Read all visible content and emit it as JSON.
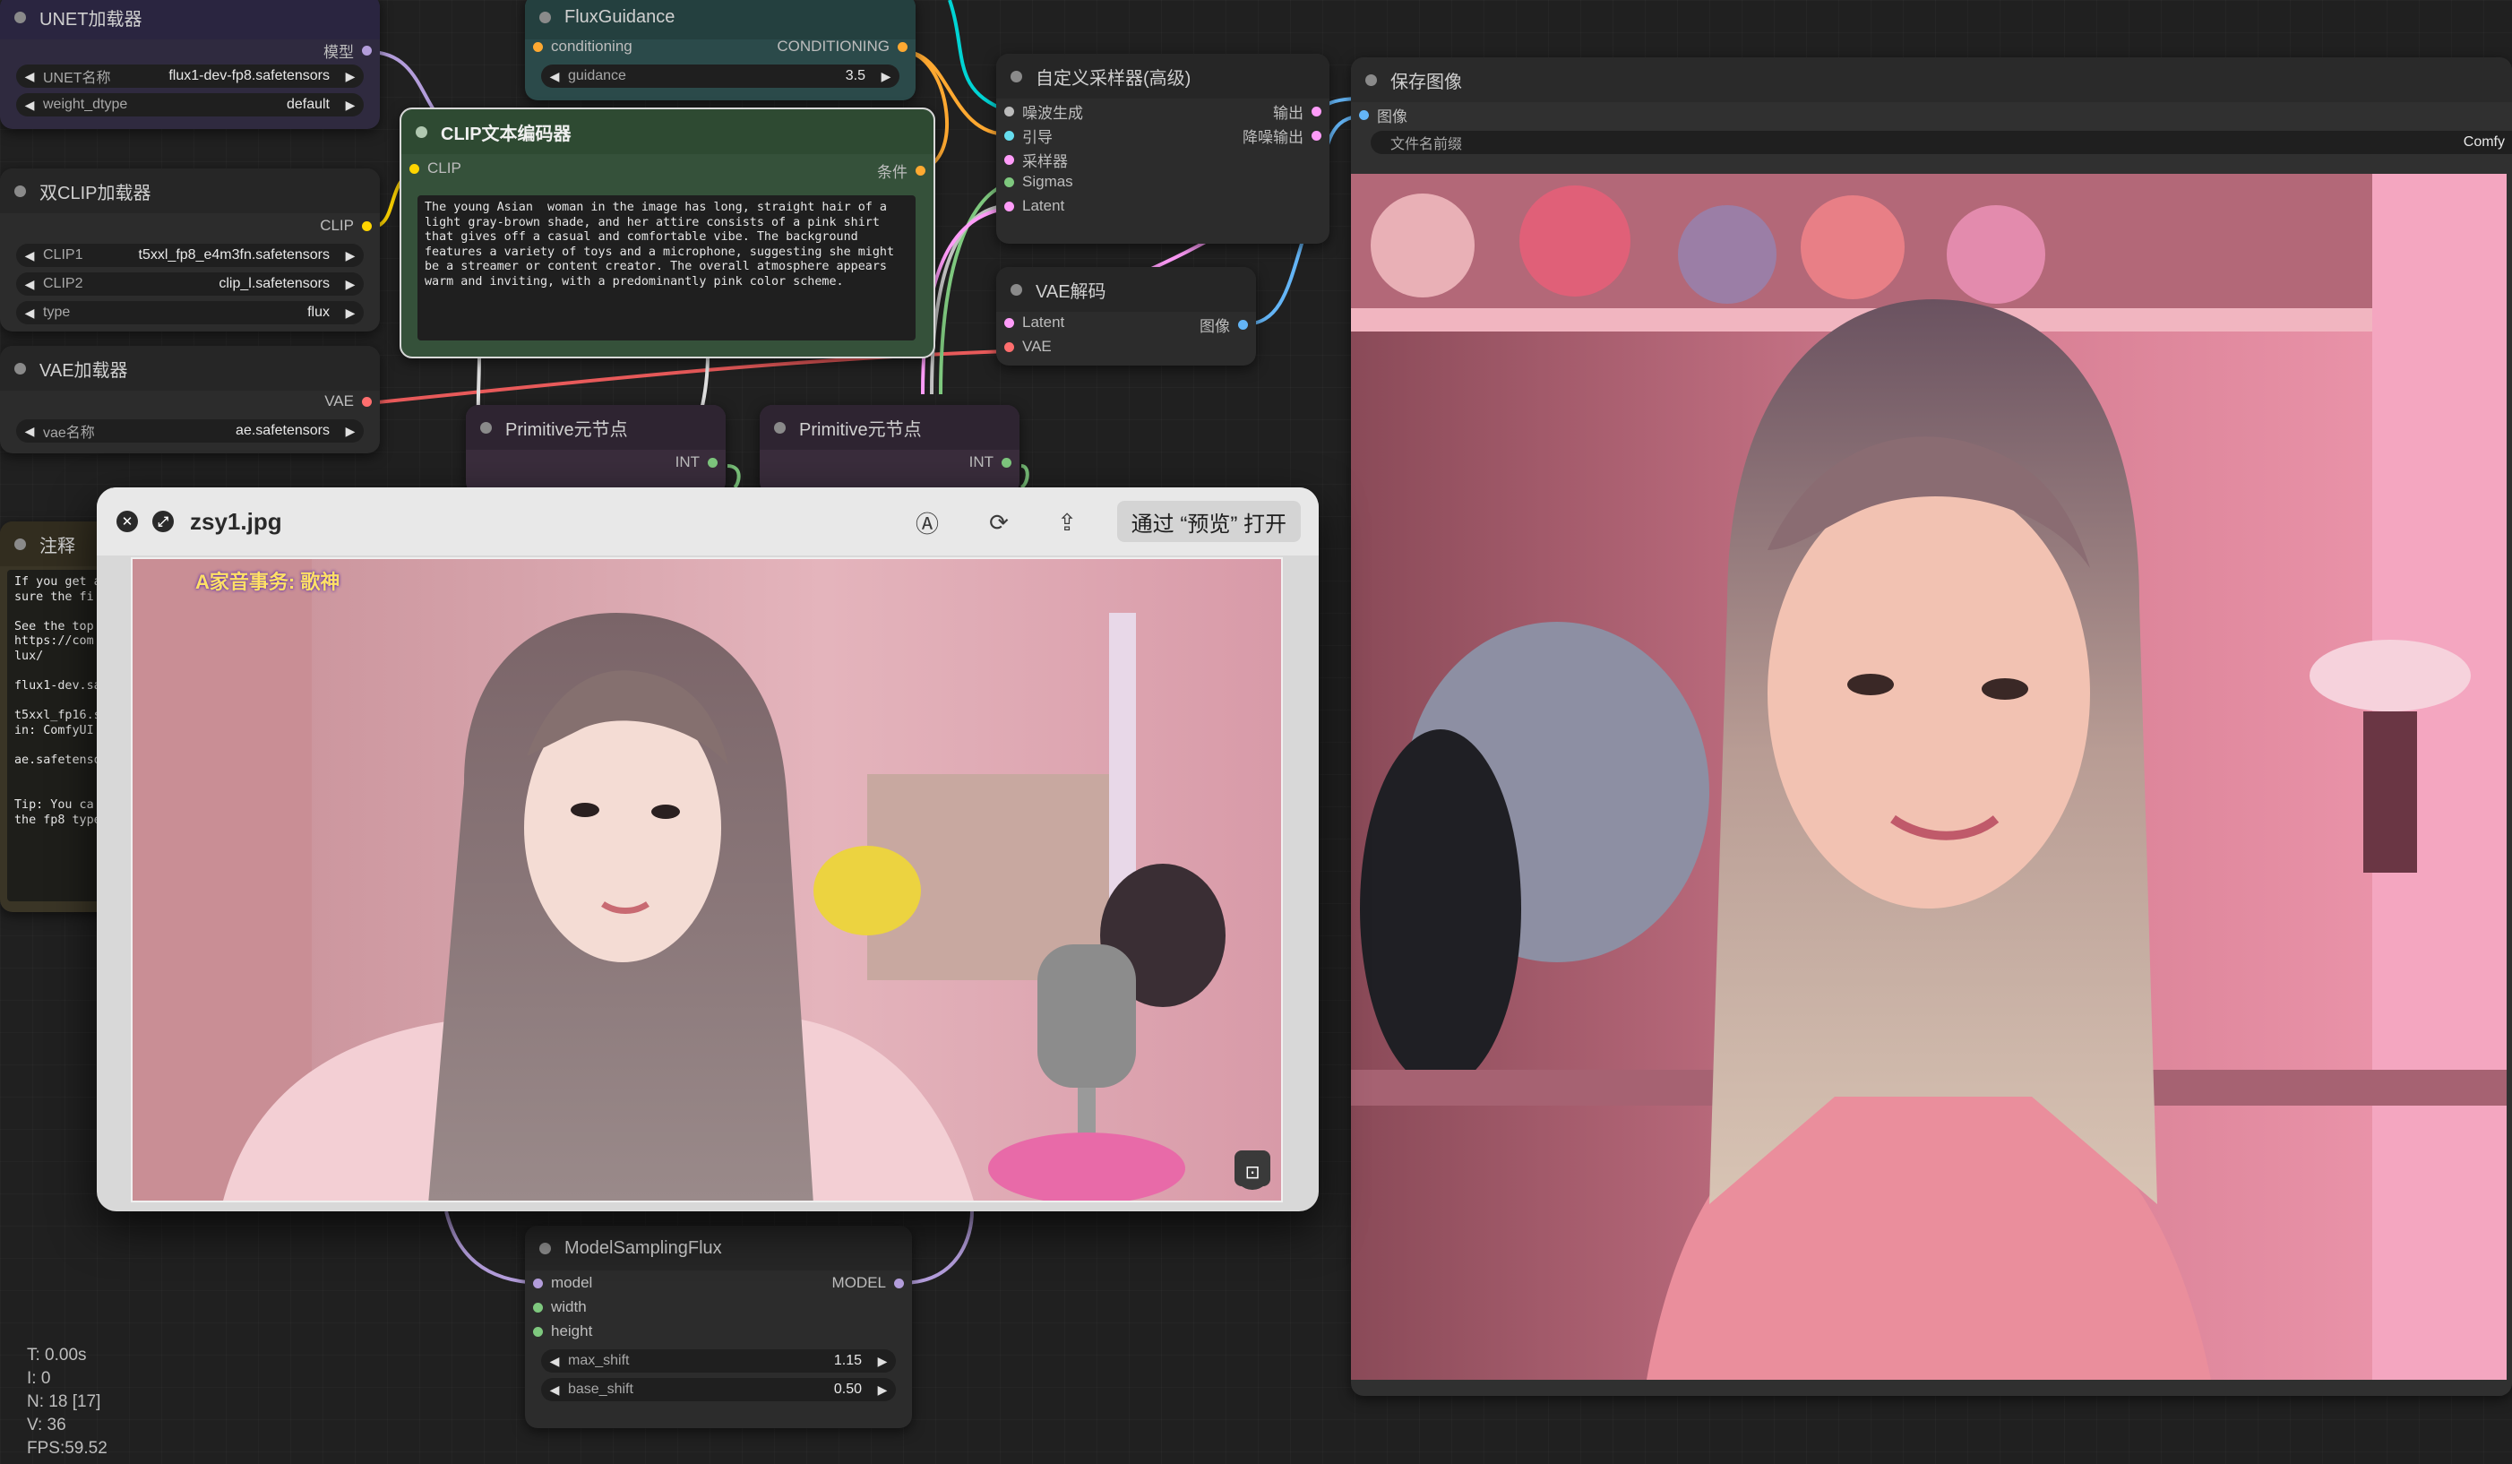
{
  "nodes": {
    "unet": {
      "title": "UNET加载器",
      "out_model": "模型",
      "w1_label": "UNET名称",
      "w1_value": "flux1-dev-fp8.safetensors",
      "w2_label": "weight_dtype",
      "w2_value": "default"
    },
    "dual_clip": {
      "title": "双CLIP加载器",
      "out_clip": "CLIP",
      "w1_label": "CLIP1",
      "w1_value": "t5xxl_fp8_e4m3fn.safetensors",
      "w2_label": "CLIP2",
      "w2_value": "clip_l.safetensors",
      "w3_label": "type",
      "w3_value": "flux"
    },
    "vae_loader": {
      "title": "VAE加载器",
      "out_vae": "VAE",
      "w1_label": "vae名称",
      "w1_value": "ae.safetensors"
    },
    "note": {
      "title": "注释",
      "text": "If you get a\nsure the fi\n\nSee the top\nhttps://com\nlux/\n\nflux1-dev.sa\n\nt5xxl_fp16.s\nin: ComfyUI\n\nae.safetenso\n\n\nTip: You ca\nthe fp8 type"
    },
    "flux_guidance": {
      "title": "FluxGuidance",
      "in_cond": "conditioning",
      "out_cond": "CONDITIONING",
      "w1_label": "guidance",
      "w1_value": "3.5"
    },
    "clip_text": {
      "title": "CLIP文本编码器",
      "in_clip": "CLIP",
      "out_cond": "条件",
      "text": "The young Asian  woman in the image has long, straight hair of a light gray-brown shade, and her attire consists of a pink shirt that gives off a casual and comfortable vibe. The background features a variety of toys and a microphone, suggesting she might be a streamer or content creator. The overall atmosphere appears warm and inviting, with a predominantly pink color scheme."
    },
    "sampler": {
      "title": "自定义采样器(高级)",
      "in1": "噪波生成",
      "in2": "引导",
      "in3": "采样器",
      "in4": "Sigmas",
      "in5": "Latent",
      "out1": "输出",
      "out2": "降噪输出"
    },
    "vae_decode": {
      "title": "VAE解码",
      "in1": "Latent",
      "in2": "VAE",
      "out1": "图像"
    },
    "prim1": {
      "title": "Primitive元节点",
      "out": "INT"
    },
    "prim2": {
      "title": "Primitive元节点",
      "out": "INT"
    },
    "save_image": {
      "title": "保存图像",
      "in1": "图像",
      "w1_label": "文件名前缀",
      "w1_value": "Comfy"
    },
    "model_sampling": {
      "title": "ModelSamplingFlux",
      "in1": "model",
      "in2": "width",
      "in3": "height",
      "out1": "MODEL",
      "w1_label": "max_shift",
      "w1_value": "1.15",
      "w2_label": "base_shift",
      "w2_value": "0.50"
    }
  },
  "quicklook": {
    "filename": "zsy1.jpg",
    "open_button": "通过 “预览” 打开",
    "overlay_caption": "A家音事务: 歌神",
    "icons": [
      "close-icon",
      "fullscreen-icon",
      "markup-icon",
      "rotate-icon",
      "share-icon"
    ]
  },
  "stats": {
    "t": "T: 0.00s",
    "i": "I: 0",
    "n": "N: 18 [17]",
    "v": "V: 36",
    "fps": "FPS:59.52"
  },
  "colors": {
    "canvas": "#202020",
    "link_model": "#b39ddb",
    "link_clip": "#ffd500",
    "link_vae": "#ff6e6e",
    "link_cond": "#ffa931",
    "link_latent": "#ff9cf9",
    "link_image": "#64b5f6",
    "link_teal": "#00d4d4",
    "link_green": "#7ec87e"
  }
}
